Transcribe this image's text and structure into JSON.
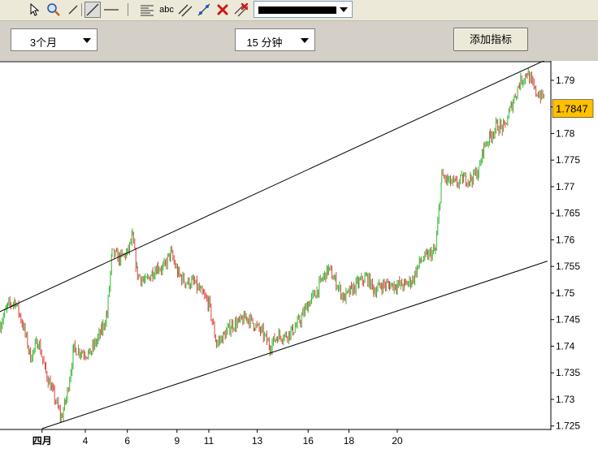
{
  "toolbar": {
    "icons": [
      "cursor-icon",
      "zoom-icon",
      "line-icon",
      "ray-line-icon",
      "horizontal-line-icon",
      "fib-lines-icon",
      "text-icon",
      "channel-icon",
      "trend-tool-icon",
      "delete-icon",
      "delete-all-icon"
    ],
    "text_tool_label": "abc",
    "line_color": "#000000"
  },
  "controls": {
    "range_select": "3个月",
    "interval_select": "15 分钟",
    "add_indicator_button": "添加指标"
  },
  "colors": {
    "up_candle": "#2fb82f",
    "down_candle": "#e04040",
    "current_price_bg": "#ffc000",
    "channel_line": "#000000"
  },
  "current_price": "1.7847",
  "chart_data": {
    "type": "candlestick",
    "title": "",
    "xlabel": "",
    "ylabel": "",
    "y_range": [
      1.7245,
      1.7935
    ],
    "y_ticks": [
      "1.725",
      "1.73",
      "1.735",
      "1.74",
      "1.745",
      "1.75",
      "1.755",
      "1.76",
      "1.765",
      "1.77",
      "1.775",
      "1.78",
      "1.785",
      "1.79"
    ],
    "x_ticks": [
      "四月",
      "4",
      "6",
      "9",
      "11",
      "13",
      "16",
      "18",
      "20"
    ],
    "series": [
      {
        "path_points": [
          [
            0.0,
            1.744
          ],
          [
            0.3,
            1.7475
          ],
          [
            0.6,
            1.7485
          ],
          [
            0.9,
            1.744
          ],
          [
            1.2,
            1.738
          ],
          [
            1.5,
            1.741
          ],
          [
            1.8,
            1.735
          ],
          [
            2.1,
            1.731
          ],
          [
            2.4,
            1.7265
          ],
          [
            2.6,
            1.73
          ],
          [
            2.9,
            1.7395
          ],
          [
            3.2,
            1.739
          ],
          [
            3.5,
            1.7385
          ],
          [
            3.8,
            1.741
          ],
          [
            4.0,
            1.743
          ],
          [
            4.2,
            1.746
          ],
          [
            4.4,
            1.7575
          ],
          [
            4.7,
            1.7565
          ],
          [
            5.0,
            1.7575
          ],
          [
            5.2,
            1.7605
          ],
          [
            5.4,
            1.7535
          ],
          [
            5.7,
            1.752
          ],
          [
            6.0,
            1.754
          ],
          [
            6.2,
            1.755
          ],
          [
            6.4,
            1.7545
          ],
          [
            6.7,
            1.7575
          ],
          [
            7.0,
            1.7535
          ],
          [
            7.3,
            1.752
          ],
          [
            7.6,
            1.752
          ],
          [
            7.9,
            1.75
          ],
          [
            8.2,
            1.748
          ],
          [
            8.5,
            1.7405
          ],
          [
            8.8,
            1.742
          ],
          [
            9.1,
            1.744
          ],
          [
            9.4,
            1.7445
          ],
          [
            9.7,
            1.7455
          ],
          [
            10.0,
            1.744
          ],
          [
            10.3,
            1.7425
          ],
          [
            10.6,
            1.74
          ],
          [
            10.9,
            1.742
          ],
          [
            11.2,
            1.742
          ],
          [
            11.5,
            1.743
          ],
          [
            11.8,
            1.745
          ],
          [
            12.1,
            1.748
          ],
          [
            12.4,
            1.75
          ],
          [
            12.7,
            1.753
          ],
          [
            12.9,
            1.7545
          ],
          [
            13.2,
            1.752
          ],
          [
            13.5,
            1.749
          ],
          [
            13.8,
            1.7505
          ],
          [
            14.1,
            1.752
          ],
          [
            14.4,
            1.753
          ],
          [
            14.7,
            1.7505
          ],
          [
            15.0,
            1.7515
          ],
          [
            15.3,
            1.7515
          ],
          [
            15.6,
            1.7515
          ],
          [
            15.9,
            1.7515
          ],
          [
            16.2,
            1.7525
          ],
          [
            16.5,
            1.756
          ],
          [
            16.8,
            1.757
          ],
          [
            17.1,
            1.758
          ],
          [
            17.35,
            1.772
          ],
          [
            17.6,
            1.771
          ],
          [
            17.9,
            1.7705
          ],
          [
            18.2,
            1.7715
          ],
          [
            18.5,
            1.7715
          ],
          [
            18.8,
            1.773
          ],
          [
            19.0,
            1.7775
          ],
          [
            19.25,
            1.7795
          ],
          [
            19.5,
            1.7815
          ],
          [
            19.8,
            1.781
          ],
          [
            20.1,
            1.7855
          ],
          [
            20.4,
            1.7895
          ],
          [
            20.7,
            1.7915
          ],
          [
            21.0,
            1.788
          ],
          [
            21.4,
            1.7865
          ]
        ]
      }
    ],
    "channel_lines": [
      {
        "name": "upper",
        "points": [
          [
            0.0,
            1.7465
          ],
          [
            21.5,
            1.794
          ]
        ]
      },
      {
        "name": "lower",
        "points": [
          [
            1.65,
            1.7245
          ],
          [
            21.5,
            1.756
          ]
        ]
      }
    ],
    "x_index_range": [
      0.0,
      21.6
    ],
    "x_tick_positions": [
      1.65,
      3.35,
      5.0,
      6.95,
      8.2,
      10.1,
      12.1,
      13.7,
      15.6
    ],
    "grid": false
  }
}
